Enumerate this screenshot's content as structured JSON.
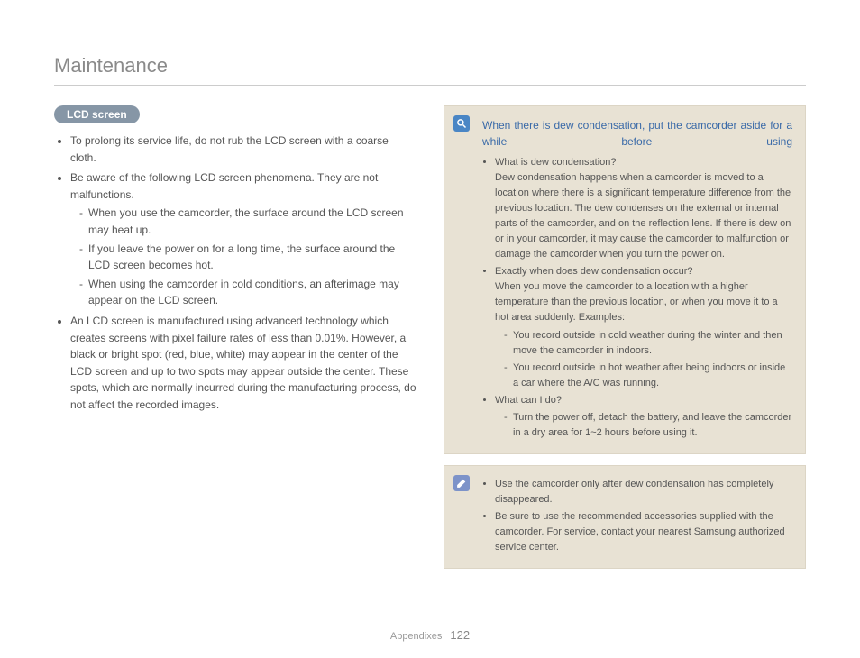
{
  "title": "Maintenance",
  "section_label": "LCD screen",
  "left": {
    "b1": "To prolong its service life, do not rub the LCD screen with a coarse cloth.",
    "b2": "Be aware of the following LCD screen phenomena. They are not malfunctions.",
    "b2s1": "When you use the camcorder, the surface around the LCD screen may heat up.",
    "b2s2": "If you leave the power on for a long time, the surface around the LCD screen becomes hot.",
    "b2s3": "When using the camcorder in cold conditions, an afterimage may appear on the LCD screen.",
    "b3": "An LCD screen is manufactured using advanced technology which creates screens with pixel failure rates of less than 0.01%. However, a black or bright spot (red, blue, white) may appear in the center of the LCD screen and up to two spots may appear outside the center. These spots, which are normally incurred during the manufacturing process, do not affect the recorded images."
  },
  "callout1": {
    "title": "When there is dew condensation, put the camcorder aside for a while before using",
    "q1": "What is dew condensation?",
    "q1body": "Dew condensation happens when a camcorder is moved to a location where there is a significant temperature difference from the previous location. The dew condenses on the external or internal parts of the camcorder, and on the reflection lens. If there is dew on or in your camcorder, it may cause the camcorder to malfunction or damage the camcorder when you turn the power on.",
    "q2": "Exactly when does dew condensation occur?",
    "q2body": "When you move the camcorder to a location with a higher temperature than the previous location, or when you move it to a hot area suddenly. Examples:",
    "q2s1": "You record outside in cold weather during the winter and then move the camcorder in indoors.",
    "q2s2": "You record outside in hot weather after being indoors or inside a car where the A/C was running.",
    "q3": "What can I do?",
    "q3s1": "Turn the power off, detach the battery, and leave the camcorder in a dry area for 1~2 hours before using it."
  },
  "callout2": {
    "b1": "Use the camcorder only after dew condensation has completely disappeared.",
    "b2": "Be sure to use the recommended accessories supplied with the camcorder. For service, contact your nearest Samsung authorized service center."
  },
  "footer": {
    "section": "Appendixes",
    "page": "122"
  }
}
